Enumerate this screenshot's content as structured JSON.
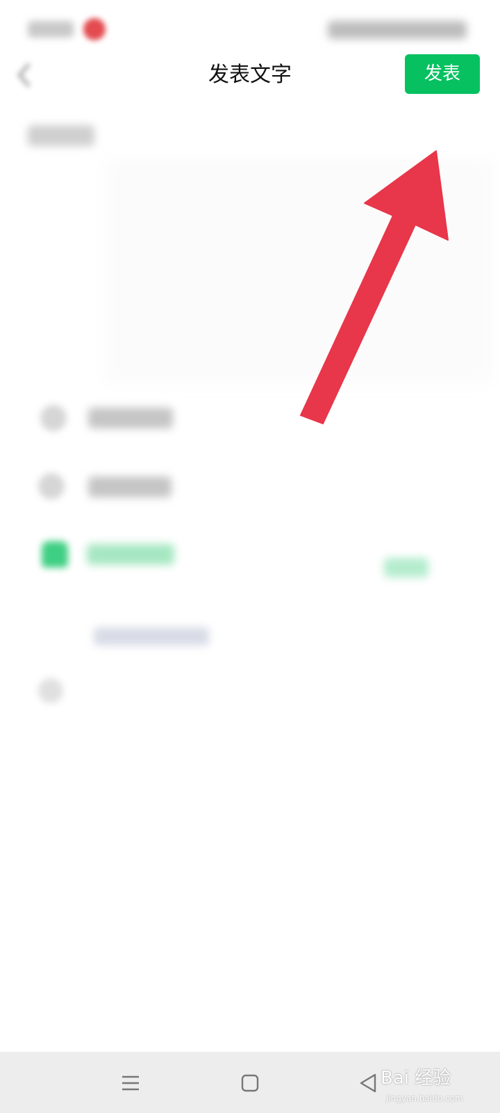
{
  "header": {
    "title": "发表文字",
    "post_label": "发表"
  },
  "colors": {
    "accent_green": "#07c160",
    "annotation_arrow": "#e8364a",
    "nav_bar_bg": "#ededed"
  },
  "icons": {
    "back": "back-chevron-icon",
    "nav_menu": "menu-lines-icon",
    "nav_home": "home-square-icon",
    "nav_back": "back-triangle-icon",
    "annotation": "red-arrow-icon"
  },
  "watermark": {
    "text": "Bai 经验",
    "sub": "jingyan.baidu.com"
  }
}
